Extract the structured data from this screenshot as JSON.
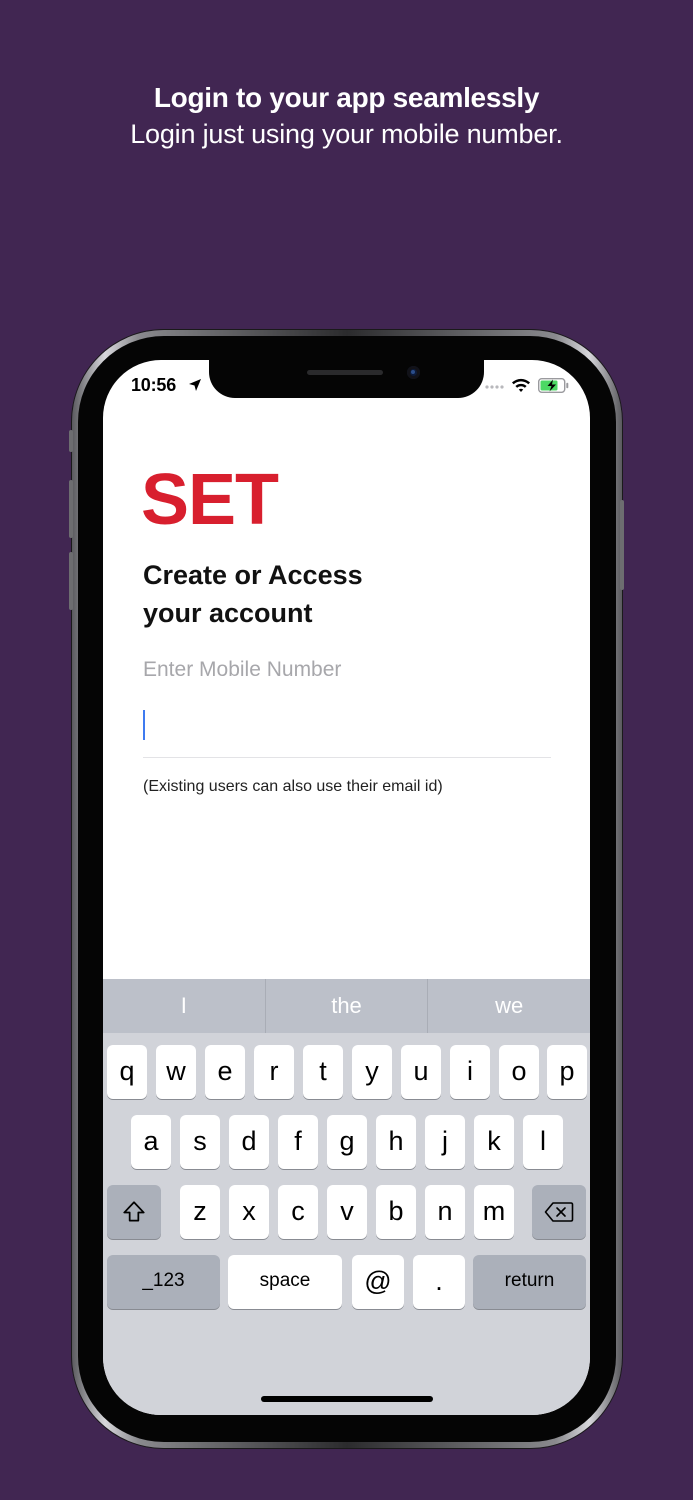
{
  "promo": {
    "title": "Login to your app seamlessly",
    "subtitle": "Login just using your mobile number."
  },
  "status_bar": {
    "time": "10:56"
  },
  "app": {
    "logo_text": "SET",
    "logo_color": "#d81f2e",
    "heading_line1": "Create or Access",
    "heading_line2": "your account",
    "mobile_label": "Enter Mobile Number",
    "mobile_value": "",
    "hint": "(Existing users can also use their email id)"
  },
  "keyboard": {
    "suggestions": [
      "I",
      "the",
      "we"
    ],
    "row1": [
      "q",
      "w",
      "e",
      "r",
      "t",
      "y",
      "u",
      "i",
      "o",
      "p"
    ],
    "row2": [
      "a",
      "s",
      "d",
      "f",
      "g",
      "h",
      "j",
      "k",
      "l"
    ],
    "row3": [
      "z",
      "x",
      "c",
      "v",
      "b",
      "n",
      "m"
    ],
    "numbers_label": "_123",
    "space_label": "space",
    "at_label": "@",
    "period_label": ".",
    "return_label": "return"
  },
  "colors": {
    "background": "#412652",
    "cursor": "#3f7bf0"
  }
}
